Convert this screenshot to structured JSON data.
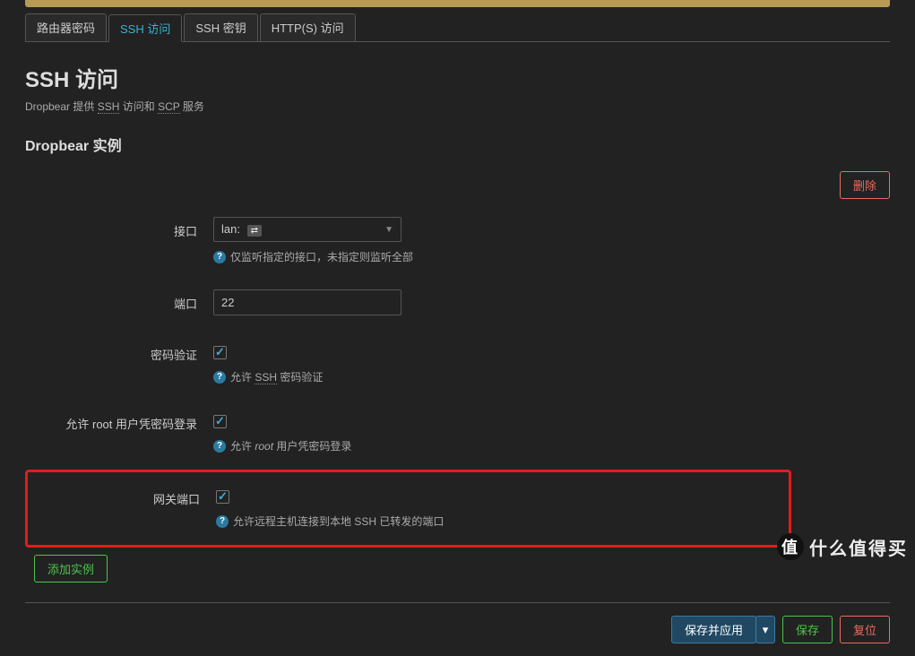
{
  "tabs": [
    {
      "label": "路由器密码"
    },
    {
      "label": "SSH 访问"
    },
    {
      "label": "SSH 密钥"
    },
    {
      "label": "HTTP(S) 访问"
    }
  ],
  "active_tab_index": 1,
  "page": {
    "title": "SSH 访问",
    "desc_prefix": "Dropbear 提供 ",
    "desc_ssh": "SSH",
    "desc_mid": " 访问和 ",
    "desc_scp": "SCP",
    "desc_suffix": " 服务"
  },
  "section": {
    "title": "Dropbear 实例"
  },
  "buttons": {
    "delete": "删除",
    "add": "添加实例",
    "save_apply": "保存并应用",
    "save": "保存",
    "reset": "复位"
  },
  "fields": {
    "interface": {
      "label": "接口",
      "value_prefix": "lan:",
      "badge": "⇄",
      "hint": "仅监听指定的接口，未指定则监听全部"
    },
    "port": {
      "label": "端口",
      "value": "22"
    },
    "password_auth": {
      "label": "密码验证",
      "checked": true,
      "hint_pre": "允许 ",
      "hint_ssh": "SSH",
      "hint_suf": " 密码验证"
    },
    "root_login": {
      "label": "允许 root 用户凭密码登录",
      "checked": true,
      "hint_pre": "允许 ",
      "hint_root": "root",
      "hint_suf": " 用户凭密码登录"
    },
    "gateway_ports": {
      "label": "网关端口",
      "checked": true,
      "hint": "允许远程主机连接到本地 SSH 已转发的端口"
    }
  },
  "watermark": {
    "icon": "值",
    "text": "什么值得买"
  }
}
